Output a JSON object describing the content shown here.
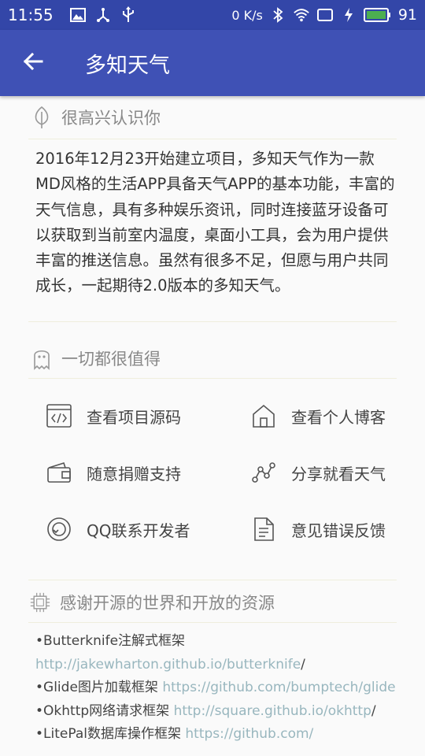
{
  "status_bar": {
    "time": "11:55",
    "net_speed": "0 K/s",
    "battery": "91",
    "battery_color": "#4caf50",
    "left_icons": [
      "image-icon",
      "usb-icon",
      "usb-trident-icon"
    ],
    "right_icons": [
      "bluetooth-icon",
      "wifi-icon",
      "cast-icon",
      "charging-icon",
      "battery-icon"
    ]
  },
  "app_bar": {
    "title": "多知天气",
    "back_icon": "arrow-left-icon",
    "color": "#3f51b5"
  },
  "about": {
    "header": "很高兴认识你",
    "header_icon": "leaf-icon",
    "text": "2016年12月23开始建立项目，多知天气作为一款MD风格的生活APP具备天气APP的基本功能，丰富的天气信息，具有多种娱乐资讯，同时连接蓝牙设备可以获取到当前室内温度，桌面小工具，会为用户提供丰富的推送信息。虽然有很多不足，但愿与用户共同成长，一起期待2.0版本的多知天气。"
  },
  "worth": {
    "header": "一切都很值得",
    "header_icon": "ghost-icon",
    "items": [
      {
        "label": "查看项目源码",
        "icon": "code-window-icon"
      },
      {
        "label": "查看个人博客",
        "icon": "home-icon"
      },
      {
        "label": "随意捐赠支持",
        "icon": "wallet-icon"
      },
      {
        "label": "分享就看天气",
        "icon": "share-graph-icon"
      },
      {
        "label": "QQ联系开发者",
        "icon": "qq-icon"
      },
      {
        "label": "意见错误反馈",
        "icon": "document-icon"
      }
    ]
  },
  "thanks": {
    "header": "感谢开源的世界和开放的资源",
    "header_icon": "chip-icon",
    "libs": [
      {
        "name": "•Butterknife注解式框架 ",
        "link": "http://jakewharton.github.io/butterknife",
        "suffix": "/"
      },
      {
        "name": " •Glide图片加载框架 ",
        "link": "https://github.com/bumptech/glide",
        "suffix": ""
      },
      {
        "name": " •Okhttp网络请求框架 ",
        "link": "http://square.github.io/okhttp",
        "suffix": "/"
      },
      {
        "name": " •LitePal数据库操作框架 ",
        "link": "https://github.com/",
        "suffix": ""
      }
    ]
  }
}
